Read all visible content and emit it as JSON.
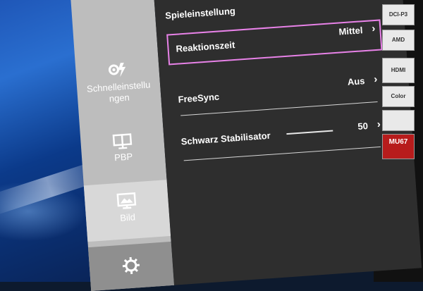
{
  "sidebar": {
    "items": [
      {
        "label": "Schnelleinstellungen",
        "icon": "quick-settings-icon"
      },
      {
        "label": "PBP",
        "icon": "monitor-icon"
      },
      {
        "label": "Bild",
        "icon": "picture-icon"
      },
      {
        "label": "",
        "icon": "gear-icon"
      }
    ]
  },
  "panel": {
    "title": "Spieleinstellung",
    "rows": [
      {
        "label": "Reaktionszeit",
        "value": "Mittel"
      },
      {
        "label": "FreeSync",
        "value": "Aus"
      },
      {
        "label": "Schwarz Stabilisator",
        "value": "50"
      }
    ]
  },
  "settings_values": {
    "schwarz_stabilisator": 50
  },
  "badges": [
    {
      "text": "DCI-P3",
      "icon": "color-gamut-badge-icon"
    },
    {
      "text": "AMD",
      "icon": "amd-badge-icon"
    },
    {
      "text": "HDMI",
      "icon": "hdmi-badge-icon"
    },
    {
      "text": "Color",
      "icon": "color-badge-icon"
    },
    {
      "text": "",
      "icon": "mode-badge-icon"
    },
    {
      "text": "MU67",
      "icon": "model-badge-icon"
    }
  ],
  "colors": {
    "selection_border": "#e882e8",
    "panel_bg": "#2e2e2e",
    "sidebar_bg": "#bdbdbd"
  }
}
